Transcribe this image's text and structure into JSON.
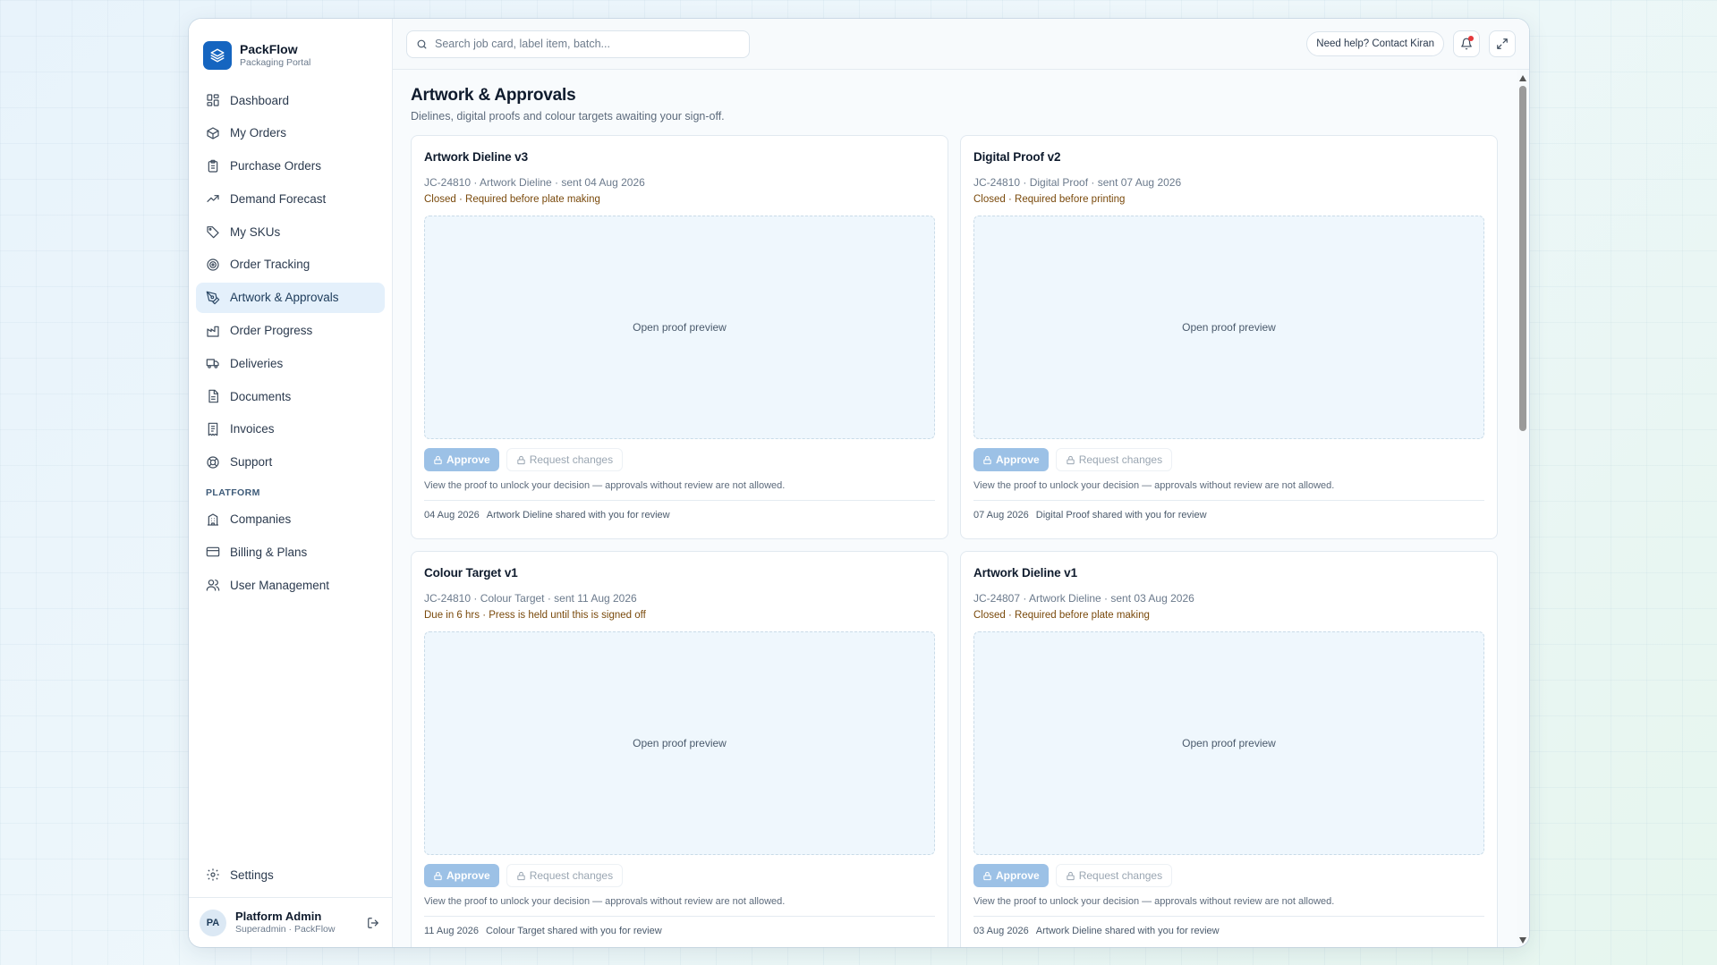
{
  "brand": {
    "name": "PackFlow",
    "subtitle": "Packaging Portal"
  },
  "sidebar": {
    "items": [
      {
        "label": "Dashboard",
        "icon": "grid-icon"
      },
      {
        "label": "My Orders",
        "icon": "box-icon"
      },
      {
        "label": "Purchase Orders",
        "icon": "clipboard-icon"
      },
      {
        "label": "Demand Forecast",
        "icon": "trend-icon"
      },
      {
        "label": "My SKUs",
        "icon": "tag-icon"
      },
      {
        "label": "Order Tracking",
        "icon": "target-icon"
      },
      {
        "label": "Artwork & Approvals",
        "icon": "pen-icon",
        "active": true
      },
      {
        "label": "Order Progress",
        "icon": "factory-icon"
      },
      {
        "label": "Deliveries",
        "icon": "truck-icon"
      },
      {
        "label": "Documents",
        "icon": "document-icon"
      },
      {
        "label": "Invoices",
        "icon": "receipt-icon"
      },
      {
        "label": "Support",
        "icon": "lifebuoy-icon"
      }
    ],
    "section_label": "PLATFORM",
    "platform_items": [
      {
        "label": "Companies",
        "icon": "building-icon"
      },
      {
        "label": "Billing & Plans",
        "icon": "card-icon"
      },
      {
        "label": "User Management",
        "icon": "users-icon"
      }
    ],
    "settings_label": "Settings"
  },
  "user": {
    "initials": "PA",
    "name": "Platform Admin",
    "role": "Superadmin · PackFlow"
  },
  "topbar": {
    "search_placeholder": "Search job card, label item, batch...",
    "help_label": "Need help? Contact Kiran"
  },
  "page": {
    "title": "Artwork & Approvals",
    "subtitle": "Dielines, digital proofs and colour targets awaiting your sign-off."
  },
  "cards": [
    {
      "title": "Artwork Dieline v3",
      "meta": "JC-24810 · Artwork Dieline · sent 04 Aug 2026",
      "status": "Closed · Required before plate making",
      "preview_label": "Open proof preview",
      "approve_label": "Approve",
      "request_label": "Request changes",
      "hint": "View the proof to unlock your decision — approvals without review are not allowed.",
      "activity_date": "04 Aug 2026",
      "activity_text": "Artwork Dieline shared with you for review"
    },
    {
      "title": "Digital Proof v2",
      "meta": "JC-24810 · Digital Proof · sent 07 Aug 2026",
      "status": "Closed · Required before printing",
      "preview_label": "Open proof preview",
      "approve_label": "Approve",
      "request_label": "Request changes",
      "hint": "View the proof to unlock your decision — approvals without review are not allowed.",
      "activity_date": "07 Aug 2026",
      "activity_text": "Digital Proof shared with you for review"
    },
    {
      "title": "Colour Target v1",
      "meta": "JC-24810 · Colour Target · sent 11 Aug 2026",
      "status": "Due in 6 hrs · Press is held until this is signed off",
      "preview_label": "Open proof preview",
      "approve_label": "Approve",
      "request_label": "Request changes",
      "hint": "View the proof to unlock your decision — approvals without review are not allowed.",
      "activity_date": "11 Aug 2026",
      "activity_text": "Colour Target shared with you for review"
    },
    {
      "title": "Artwork Dieline v1",
      "meta": "JC-24807 · Artwork Dieline · sent 03 Aug 2026",
      "status": "Closed · Required before plate making",
      "preview_label": "Open proof preview",
      "approve_label": "Approve",
      "request_label": "Request changes",
      "hint": "View the proof to unlock your decision — approvals without review are not allowed.",
      "activity_date": "03 Aug 2026",
      "activity_text": "Artwork Dieline shared with you for review"
    }
  ],
  "colors": {
    "brand": "#1565c0",
    "active_nav_bg": "#e4f0fb",
    "approve_disabled": "#9cc1e6",
    "status_text": "#7a4a0c",
    "notification_dot": "#e5383b"
  }
}
